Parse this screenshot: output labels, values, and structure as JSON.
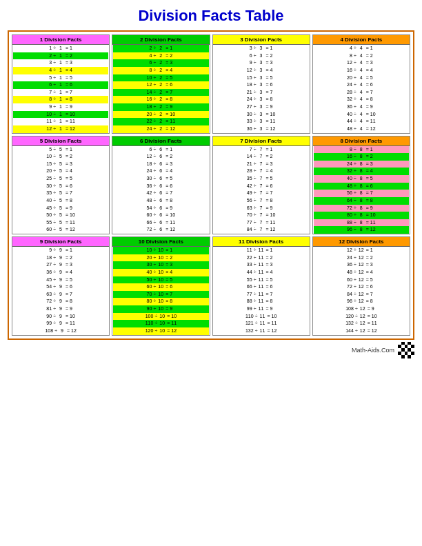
{
  "title": "Division Facts Table",
  "sections": [
    {
      "id": "s1",
      "label": "1 Division Facts",
      "headerColor": "#ff66ff",
      "divisor": 1,
      "rows": [
        {
          "a": 1,
          "b": 1,
          "eq": 1,
          "color": "#ffffff"
        },
        {
          "a": 2,
          "b": 1,
          "eq": 2,
          "color": "#00ee00"
        },
        {
          "a": 3,
          "b": 1,
          "eq": 3,
          "color": "#ffffff"
        },
        {
          "a": 4,
          "b": 1,
          "eq": 4,
          "color": "#ffff00"
        },
        {
          "a": 5,
          "b": 1,
          "eq": 5,
          "color": "#ffffff"
        },
        {
          "a": 6,
          "b": 1,
          "eq": 6,
          "color": "#00ee00"
        },
        {
          "a": 7,
          "b": 1,
          "eq": 7,
          "color": "#ffffff"
        },
        {
          "a": 8,
          "b": 1,
          "eq": 8,
          "color": "#ffff00"
        },
        {
          "a": 9,
          "b": 1,
          "eq": 9,
          "color": "#ffffff"
        },
        {
          "a": 10,
          "b": 1,
          "eq": 10,
          "color": "#00ee00"
        },
        {
          "a": 11,
          "b": 1,
          "eq": 11,
          "color": "#ffffff"
        },
        {
          "a": 12,
          "b": 1,
          "eq": 12,
          "color": "#ffff00"
        }
      ]
    },
    {
      "id": "s2",
      "label": "2 Division Facts",
      "headerColor": "#00dd00",
      "divisor": 2,
      "rows": [
        {
          "a": 2,
          "b": 2,
          "eq": 1,
          "color": "#00ee00"
        },
        {
          "a": 4,
          "b": 2,
          "eq": 2,
          "color": "#ffff00"
        },
        {
          "a": 6,
          "b": 2,
          "eq": 3,
          "color": "#00ee00"
        },
        {
          "a": 8,
          "b": 2,
          "eq": 4,
          "color": "#ffff00"
        },
        {
          "a": 10,
          "b": 2,
          "eq": 5,
          "color": "#00ee00"
        },
        {
          "a": 12,
          "b": 2,
          "eq": 6,
          "color": "#ffff00"
        },
        {
          "a": 14,
          "b": 2,
          "eq": 7,
          "color": "#00ee00"
        },
        {
          "a": 16,
          "b": 2,
          "eq": 8,
          "color": "#ffff00"
        },
        {
          "a": 18,
          "b": 2,
          "eq": 9,
          "color": "#00ee00"
        },
        {
          "a": 20,
          "b": 2,
          "eq": 10,
          "color": "#ffff00"
        },
        {
          "a": 22,
          "b": 2,
          "eq": 11,
          "color": "#00ee00"
        },
        {
          "a": 24,
          "b": 2,
          "eq": 12,
          "color": "#ffff00"
        }
      ]
    },
    {
      "id": "s3",
      "label": "3 Division Facts",
      "headerColor": "#ffff00",
      "divisor": 3,
      "rows": [
        {
          "a": 3,
          "b": 3,
          "eq": 1,
          "color": "#ffffff"
        },
        {
          "a": 6,
          "b": 3,
          "eq": 2,
          "color": "#ffffff"
        },
        {
          "a": 9,
          "b": 3,
          "eq": 3,
          "color": "#ffffff"
        },
        {
          "a": 12,
          "b": 3,
          "eq": 4,
          "color": "#ffffff"
        },
        {
          "a": 15,
          "b": 3,
          "eq": 5,
          "color": "#ffffff"
        },
        {
          "a": 18,
          "b": 3,
          "eq": 6,
          "color": "#ffffff"
        },
        {
          "a": 21,
          "b": 3,
          "eq": 7,
          "color": "#ffffff"
        },
        {
          "a": 24,
          "b": 3,
          "eq": 8,
          "color": "#ffffff"
        },
        {
          "a": 27,
          "b": 3,
          "eq": 9,
          "color": "#ffffff"
        },
        {
          "a": 30,
          "b": 3,
          "eq": 10,
          "color": "#ffffff"
        },
        {
          "a": 33,
          "b": 3,
          "eq": 11,
          "color": "#ffffff"
        },
        {
          "a": 36,
          "b": 3,
          "eq": 12,
          "color": "#ffffff"
        }
      ]
    },
    {
      "id": "s4",
      "label": "4 Division Facts",
      "headerColor": "#ff9900",
      "divisor": 4,
      "rows": [
        {
          "a": 4,
          "b": 4,
          "eq": 1,
          "color": "#ffffff"
        },
        {
          "a": 8,
          "b": 4,
          "eq": 2,
          "color": "#ffffff"
        },
        {
          "a": 12,
          "b": 4,
          "eq": 3,
          "color": "#ffffff"
        },
        {
          "a": 16,
          "b": 4,
          "eq": 4,
          "color": "#ffffff"
        },
        {
          "a": 20,
          "b": 4,
          "eq": 5,
          "color": "#ffffff"
        },
        {
          "a": 24,
          "b": 4,
          "eq": 6,
          "color": "#ffffff"
        },
        {
          "a": 28,
          "b": 4,
          "eq": 7,
          "color": "#ffffff"
        },
        {
          "a": 32,
          "b": 4,
          "eq": 8,
          "color": "#ffffff"
        },
        {
          "a": 36,
          "b": 4,
          "eq": 9,
          "color": "#ffffff"
        },
        {
          "a": 40,
          "b": 4,
          "eq": 10,
          "color": "#ffffff"
        },
        {
          "a": 44,
          "b": 4,
          "eq": 11,
          "color": "#ffffff"
        },
        {
          "a": 48,
          "b": 4,
          "eq": 12,
          "color": "#ffffff"
        }
      ]
    },
    {
      "id": "s5",
      "label": "5 Division Facts",
      "headerColor": "#ff66ff",
      "divisor": 5,
      "rows": [
        {
          "a": 5,
          "b": 5,
          "eq": 1,
          "color": "#ffffff"
        },
        {
          "a": 10,
          "b": 5,
          "eq": 2,
          "color": "#ffffff"
        },
        {
          "a": 15,
          "b": 5,
          "eq": 3,
          "color": "#ffffff"
        },
        {
          "a": 20,
          "b": 5,
          "eq": 4,
          "color": "#ffffff"
        },
        {
          "a": 25,
          "b": 5,
          "eq": 5,
          "color": "#ffffff"
        },
        {
          "a": 30,
          "b": 5,
          "eq": 6,
          "color": "#ffffff"
        },
        {
          "a": 35,
          "b": 5,
          "eq": 7,
          "color": "#ffffff"
        },
        {
          "a": 40,
          "b": 5,
          "eq": 8,
          "color": "#ffffff"
        },
        {
          "a": 45,
          "b": 5,
          "eq": 9,
          "color": "#ffffff"
        },
        {
          "a": 50,
          "b": 5,
          "eq": 10,
          "color": "#ffffff"
        },
        {
          "a": 55,
          "b": 5,
          "eq": 11,
          "color": "#ffffff"
        },
        {
          "a": 60,
          "b": 5,
          "eq": 12,
          "color": "#ffffff"
        }
      ]
    },
    {
      "id": "s6",
      "label": "6 Division Facts",
      "headerColor": "#00cc00",
      "divisor": 6,
      "rows": [
        {
          "a": 6,
          "b": 6,
          "eq": 1,
          "color": "#ffffff"
        },
        {
          "a": 12,
          "b": 6,
          "eq": 2,
          "color": "#ffffff"
        },
        {
          "a": 18,
          "b": 6,
          "eq": 3,
          "color": "#ffffff"
        },
        {
          "a": 24,
          "b": 6,
          "eq": 4,
          "color": "#ffffff"
        },
        {
          "a": 30,
          "b": 6,
          "eq": 5,
          "color": "#ffffff"
        },
        {
          "a": 36,
          "b": 6,
          "eq": 6,
          "color": "#ffffff"
        },
        {
          "a": 42,
          "b": 6,
          "eq": 7,
          "color": "#ffffff"
        },
        {
          "a": 48,
          "b": 6,
          "eq": 8,
          "color": "#ffffff"
        },
        {
          "a": 54,
          "b": 6,
          "eq": 9,
          "color": "#ffffff"
        },
        {
          "a": 60,
          "b": 6,
          "eq": 10,
          "color": "#ffffff"
        },
        {
          "a": 66,
          "b": 6,
          "eq": 11,
          "color": "#ffffff"
        },
        {
          "a": 72,
          "b": 6,
          "eq": 12,
          "color": "#ffffff"
        }
      ]
    },
    {
      "id": "s7",
      "label": "7 Division Facts",
      "headerColor": "#ffff00",
      "divisor": 7,
      "rows": [
        {
          "a": 7,
          "b": 7,
          "eq": 1,
          "color": "#ffffff"
        },
        {
          "a": 14,
          "b": 7,
          "eq": 2,
          "color": "#ffffff"
        },
        {
          "a": 21,
          "b": 7,
          "eq": 3,
          "color": "#ffffff"
        },
        {
          "a": 28,
          "b": 7,
          "eq": 4,
          "color": "#ffffff"
        },
        {
          "a": 35,
          "b": 7,
          "eq": 5,
          "color": "#ffffff"
        },
        {
          "a": 42,
          "b": 7,
          "eq": 6,
          "color": "#ffffff"
        },
        {
          "a": 49,
          "b": 7,
          "eq": 7,
          "color": "#ffffff"
        },
        {
          "a": 56,
          "b": 7,
          "eq": 8,
          "color": "#ffffff"
        },
        {
          "a": 63,
          "b": 7,
          "eq": 9,
          "color": "#ffffff"
        },
        {
          "a": 70,
          "b": 7,
          "eq": 10,
          "color": "#ffffff"
        },
        {
          "a": 77,
          "b": 7,
          "eq": 11,
          "color": "#ffffff"
        },
        {
          "a": 84,
          "b": 7,
          "eq": 12,
          "color": "#ffffff"
        }
      ]
    },
    {
      "id": "s8",
      "label": "8 Division Facts",
      "headerColor": "#ff9900",
      "divisor": 8,
      "rows": [
        {
          "a": 8,
          "b": 8,
          "eq": 1,
          "color": "#ff99cc"
        },
        {
          "a": 16,
          "b": 8,
          "eq": 2,
          "color": "#00ee00"
        },
        {
          "a": 24,
          "b": 8,
          "eq": 3,
          "color": "#ff99cc"
        },
        {
          "a": 32,
          "b": 8,
          "eq": 4,
          "color": "#00ee00"
        },
        {
          "a": 40,
          "b": 8,
          "eq": 5,
          "color": "#ff99cc"
        },
        {
          "a": 48,
          "b": 8,
          "eq": 6,
          "color": "#00ee00"
        },
        {
          "a": 56,
          "b": 8,
          "eq": 7,
          "color": "#ff99cc"
        },
        {
          "a": 64,
          "b": 8,
          "eq": 8,
          "color": "#00ee00"
        },
        {
          "a": 72,
          "b": 8,
          "eq": 9,
          "color": "#ff99cc"
        },
        {
          "a": 80,
          "b": 8,
          "eq": 10,
          "color": "#00ee00"
        },
        {
          "a": 88,
          "b": 8,
          "eq": 11,
          "color": "#ff99cc"
        },
        {
          "a": 96,
          "b": 8,
          "eq": 12,
          "color": "#00ee00"
        }
      ]
    },
    {
      "id": "s9",
      "label": "9 Division Facts",
      "headerColor": "#ff66ff",
      "divisor": 9,
      "rows": [
        {
          "a": 9,
          "b": 9,
          "eq": 1,
          "color": "#ffffff"
        },
        {
          "a": 18,
          "b": 9,
          "eq": 2,
          "color": "#ffffff"
        },
        {
          "a": 27,
          "b": 9,
          "eq": 3,
          "color": "#ffffff"
        },
        {
          "a": 36,
          "b": 9,
          "eq": 4,
          "color": "#ffffff"
        },
        {
          "a": 45,
          "b": 9,
          "eq": 5,
          "color": "#ffffff"
        },
        {
          "a": 54,
          "b": 9,
          "eq": 6,
          "color": "#ffffff"
        },
        {
          "a": 63,
          "b": 9,
          "eq": 7,
          "color": "#ffffff"
        },
        {
          "a": 72,
          "b": 9,
          "eq": 8,
          "color": "#ffffff"
        },
        {
          "a": 81,
          "b": 9,
          "eq": 9,
          "color": "#ffffff"
        },
        {
          "a": 90,
          "b": 9,
          "eq": 10,
          "color": "#ffffff"
        },
        {
          "a": 99,
          "b": 9,
          "eq": 11,
          "color": "#ffffff"
        },
        {
          "a": 108,
          "b": 9,
          "eq": 12,
          "color": "#ffffff"
        }
      ]
    },
    {
      "id": "s10",
      "label": "10 Division Facts",
      "headerColor": "#00cc00",
      "divisor": 10,
      "rows": [
        {
          "a": 10,
          "b": 10,
          "eq": 1,
          "color": "#00ee00"
        },
        {
          "a": 20,
          "b": 10,
          "eq": 2,
          "color": "#ffff00"
        },
        {
          "a": 30,
          "b": 10,
          "eq": 3,
          "color": "#00ee00"
        },
        {
          "a": 40,
          "b": 10,
          "eq": 4,
          "color": "#ffff00"
        },
        {
          "a": 50,
          "b": 10,
          "eq": 5,
          "color": "#00ee00"
        },
        {
          "a": 60,
          "b": 10,
          "eq": 6,
          "color": "#ffff00"
        },
        {
          "a": 70,
          "b": 10,
          "eq": 7,
          "color": "#00ee00"
        },
        {
          "a": 80,
          "b": 10,
          "eq": 8,
          "color": "#ffff00"
        },
        {
          "a": 90,
          "b": 10,
          "eq": 9,
          "color": "#00ee00"
        },
        {
          "a": 100,
          "b": 10,
          "eq": 10,
          "color": "#ffff00"
        },
        {
          "a": 110,
          "b": 10,
          "eq": 11,
          "color": "#00ee00"
        },
        {
          "a": 120,
          "b": 10,
          "eq": 12,
          "color": "#ffff00"
        }
      ]
    },
    {
      "id": "s11",
      "label": "11 Division Facts",
      "headerColor": "#ffff00",
      "divisor": 11,
      "rows": [
        {
          "a": 11,
          "b": 11,
          "eq": 1,
          "color": "#ffffff"
        },
        {
          "a": 22,
          "b": 11,
          "eq": 2,
          "color": "#ffffff"
        },
        {
          "a": 33,
          "b": 11,
          "eq": 3,
          "color": "#ffffff"
        },
        {
          "a": 44,
          "b": 11,
          "eq": 4,
          "color": "#ffffff"
        },
        {
          "a": 55,
          "b": 11,
          "eq": 5,
          "color": "#ffffff"
        },
        {
          "a": 66,
          "b": 11,
          "eq": 6,
          "color": "#ffffff"
        },
        {
          "a": 77,
          "b": 11,
          "eq": 7,
          "color": "#ffffff"
        },
        {
          "a": 88,
          "b": 11,
          "eq": 8,
          "color": "#ffffff"
        },
        {
          "a": 99,
          "b": 11,
          "eq": 9,
          "color": "#ffffff"
        },
        {
          "a": 110,
          "b": 11,
          "eq": 10,
          "color": "#ffffff"
        },
        {
          "a": 121,
          "b": 11,
          "eq": 11,
          "color": "#ffffff"
        },
        {
          "a": 132,
          "b": 11,
          "eq": 12,
          "color": "#ffffff"
        }
      ]
    },
    {
      "id": "s12",
      "label": "12 Division Facts",
      "headerColor": "#ff9900",
      "divisor": 12,
      "rows": [
        {
          "a": 12,
          "b": 12,
          "eq": 1,
          "color": "#ffffff"
        },
        {
          "a": 24,
          "b": 12,
          "eq": 2,
          "color": "#ffffff"
        },
        {
          "a": 36,
          "b": 12,
          "eq": 3,
          "color": "#ffffff"
        },
        {
          "a": 48,
          "b": 12,
          "eq": 4,
          "color": "#ffffff"
        },
        {
          "a": 60,
          "b": 12,
          "eq": 5,
          "color": "#ffffff"
        },
        {
          "a": 72,
          "b": 12,
          "eq": 6,
          "color": "#ffffff"
        },
        {
          "a": 84,
          "b": 12,
          "eq": 7,
          "color": "#ffffff"
        },
        {
          "a": 96,
          "b": 12,
          "eq": 8,
          "color": "#ffffff"
        },
        {
          "a": 108,
          "b": 12,
          "eq": 9,
          "color": "#ffffff"
        },
        {
          "a": 120,
          "b": 12,
          "eq": 10,
          "color": "#ffffff"
        },
        {
          "a": 132,
          "b": 12,
          "eq": 11,
          "color": "#ffffff"
        },
        {
          "a": 144,
          "b": 12,
          "eq": 12,
          "color": "#ffffff"
        }
      ]
    }
  ],
  "footer": {
    "brand": "Math-Aids.Com"
  }
}
